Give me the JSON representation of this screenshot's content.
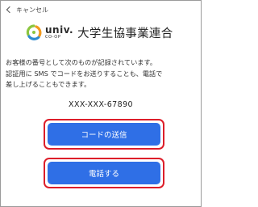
{
  "nav": {
    "back_label": "キャンセル"
  },
  "header": {
    "logo_word": "univ.",
    "logo_sub": "CO-OP",
    "org_name": "大学生協事業連合"
  },
  "message": {
    "line1": "お客様の番号として次のものが記録されています。",
    "line2": "認証用に SMS でコードをお送りすることも、電話で",
    "line3": "差し上げることもできます。"
  },
  "phone_number": "XXX-XXX-67890",
  "buttons": {
    "send_code": "コードの送信",
    "call": "電話する"
  },
  "colors": {
    "button_blue": "#2f6fe6",
    "highlight_red": "#dd1e2a",
    "logo_green": "#8cc63f",
    "logo_blue": "#2e8bcf",
    "logo_orange": "#f39a1e"
  }
}
